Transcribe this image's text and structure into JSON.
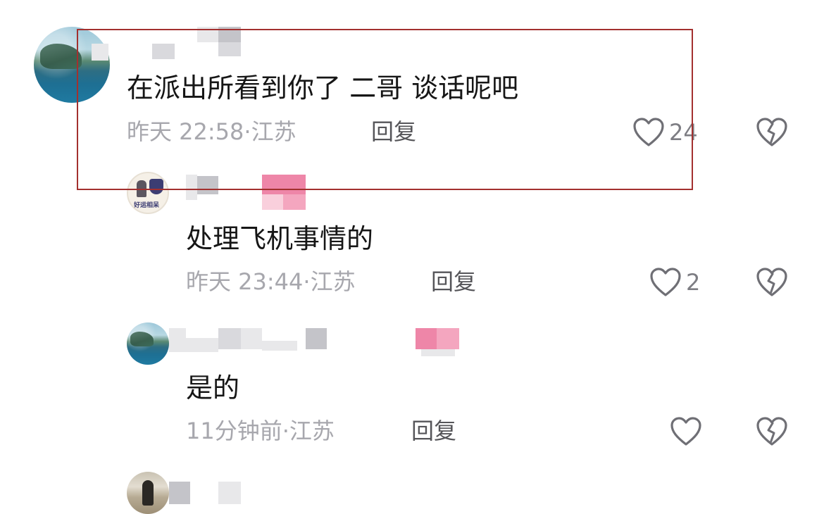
{
  "comments": [
    {
      "text": "在派出所看到你了 二哥 谈话呢吧",
      "time": "昨天 22:58",
      "sep": "·",
      "location": "江苏",
      "reply_label": "回复",
      "like_count": "24"
    },
    {
      "avatar_tag": "好运相呆",
      "text": "处理飞机事情的",
      "time": "昨天 23:44",
      "sep": "·",
      "location": "江苏",
      "reply_label": "回复",
      "like_count": "2"
    },
    {
      "text": "是的",
      "time": "11分钟前",
      "sep": "·",
      "location": "江苏",
      "reply_label": "回复",
      "like_count": ""
    }
  ],
  "colors": {
    "highlight_border": "#a3302f",
    "meta_text": "#a7a7ad",
    "reply_text": "#555559",
    "censor_pink": "#ee86a8",
    "censor_gray": "#c4c4c9"
  },
  "icons": {
    "like": "heart-outline-icon",
    "dislike": "broken-heart-icon"
  }
}
